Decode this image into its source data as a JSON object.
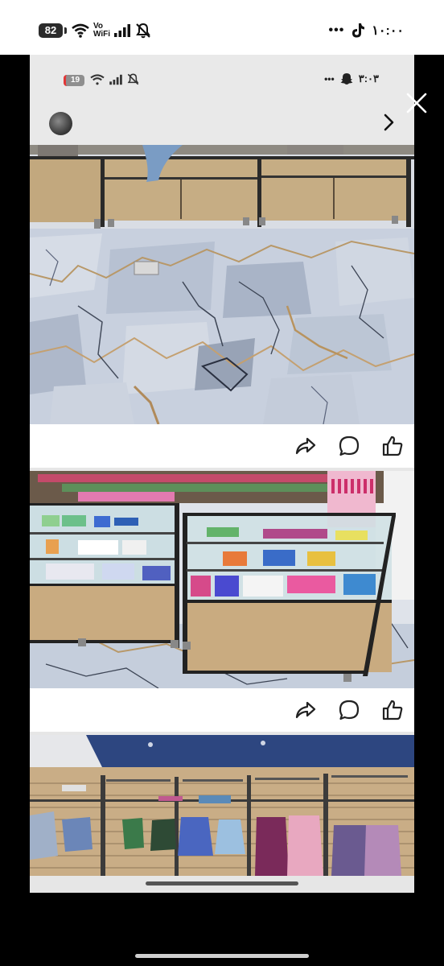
{
  "outer_status": {
    "battery": "82",
    "wifi_label_top": "Vo",
    "wifi_label_bottom": "WiFi",
    "dots": "•••",
    "time": "١٠:٠٠"
  },
  "inner_status": {
    "battery": "19",
    "dots": "•••",
    "time": "٣:٠٣"
  },
  "icons": {
    "close": "close-icon",
    "next": "chevron-right-icon",
    "share": "share-icon",
    "comment": "comment-icon",
    "like": "like-icon"
  },
  "colors": {
    "background": "#000000",
    "story_bg": "#e6e6e6",
    "action_bar": "#ffffff"
  }
}
